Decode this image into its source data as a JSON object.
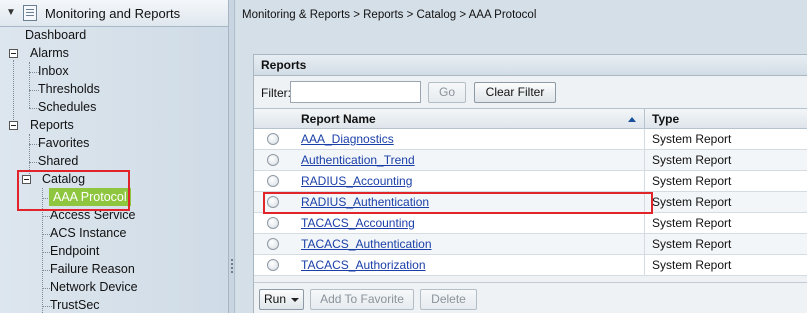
{
  "sidebar": {
    "drawer_title": "Monitoring and Reports",
    "items": {
      "dashboard": "Dashboard",
      "alarms": "Alarms",
      "inbox": "Inbox",
      "thresholds": "Thresholds",
      "schedules": "Schedules",
      "reports": "Reports",
      "favorites": "Favorites",
      "shared": "Shared",
      "catalog": "Catalog",
      "aaa_protocol": "AAA Protocol",
      "access_service": "Access Service",
      "acs_instance": "ACS Instance",
      "endpoint": "Endpoint",
      "failure_reason": "Failure Reason",
      "network_device": "Network Device",
      "trustsec": "TrustSec"
    },
    "selected": "AAA Protocol",
    "accent_color": "#8ec63f"
  },
  "breadcrumb": "Monitoring & Reports > Reports > Catalog > AAA Protocol",
  "panel": {
    "title": "Reports",
    "filter_label": "Filter:",
    "filter_value": "",
    "go_label": "Go",
    "clear_filter_label": "Clear Filter",
    "columns": {
      "name": "Report Name",
      "type": "Type"
    },
    "rows": [
      {
        "name": "AAA_Diagnostics",
        "type": "System Report"
      },
      {
        "name": "Authentication_Trend",
        "type": "System Report"
      },
      {
        "name": "RADIUS_Accounting",
        "type": "System Report"
      },
      {
        "name": "RADIUS_Authentication",
        "type": "System Report"
      },
      {
        "name": "TACACS_Accounting",
        "type": "System Report"
      },
      {
        "name": "TACACS_Authentication",
        "type": "System Report"
      },
      {
        "name": "TACACS_Authorization",
        "type": "System Report"
      }
    ],
    "run_label": "Run",
    "add_to_favorite_label": "Add To Favorite",
    "delete_label": "Delete"
  },
  "colors": {
    "link": "#1a3fa8",
    "highlight": "#e0242a"
  }
}
